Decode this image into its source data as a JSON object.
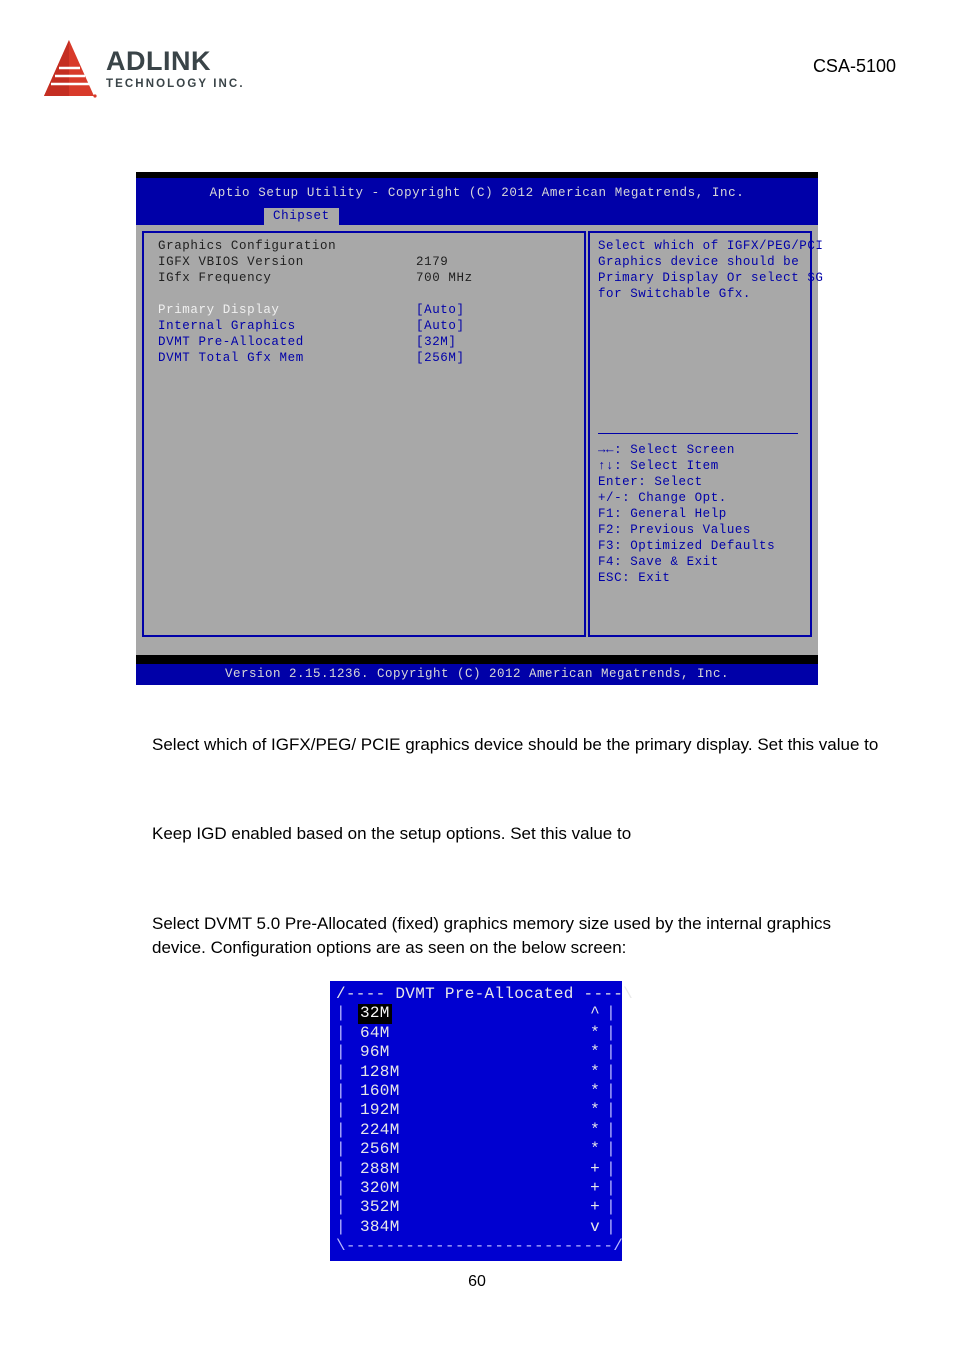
{
  "header": {
    "logo_name": "ADLINK",
    "logo_sub": "TECHNOLOGY INC.",
    "doc_id": "CSA-5100"
  },
  "bios": {
    "title": "Aptio Setup Utility - Copyright (C) 2012 American Megatrends, Inc.",
    "tab": "Chipset",
    "status": "Version 2.15.1236. Copyright (C) 2012 American Megatrends, Inc.",
    "section_heading": "Graphics Configuration",
    "info_rows": [
      {
        "label": "IGFX VBIOS Version",
        "value": "2179"
      },
      {
        "label": "IGfx Frequency",
        "value": "700 MHz"
      }
    ],
    "option_rows": [
      {
        "label": "Primary Display",
        "value": "[Auto]",
        "selected": true
      },
      {
        "label": "Internal Graphics",
        "value": "[Auto]",
        "selected": false
      },
      {
        "label": "DVMT Pre-Allocated",
        "value": "[32M]",
        "selected": false
      },
      {
        "label": "DVMT Total Gfx Mem",
        "value": "[256M]",
        "selected": false
      }
    ],
    "help_lines": [
      "Select which of IGFX/PEG/PCI",
      "Graphics device should be",
      "Primary Display Or select SG",
      "for Switchable Gfx."
    ],
    "nav_lines": [
      "→←: Select Screen",
      "↑↓: Select Item",
      "Enter: Select",
      "+/-: Change Opt.",
      "F1: General Help",
      "F2: Previous Values",
      "F3: Optimized Defaults",
      "F4: Save & Exit",
      "ESC: Exit"
    ]
  },
  "paragraphs": [
    "Select which of IGFX/PEG/ PCIE graphics device should be the primary display. Set this value to",
    "Keep IGD enabled based on the setup options. Set this value to",
    "Select DVMT 5.0 Pre-Allocated (fixed) graphics memory size used by the internal graphics device. Configuration options are as seen on the below screen:"
  ],
  "dvmt_popup": {
    "title": "/---- DVMT Pre-Allocated ----\\",
    "bottom": "\\---------------------------/",
    "border_left": "|",
    "border_right": "|",
    "items": [
      {
        "label": "32M",
        "mark": "^",
        "selected": true
      },
      {
        "label": "64M",
        "mark": "*",
        "selected": false
      },
      {
        "label": "96M",
        "mark": "*",
        "selected": false
      },
      {
        "label": "128M",
        "mark": "*",
        "selected": false
      },
      {
        "label": "160M",
        "mark": "*",
        "selected": false
      },
      {
        "label": "192M",
        "mark": "*",
        "selected": false
      },
      {
        "label": "224M",
        "mark": "*",
        "selected": false
      },
      {
        "label": "256M",
        "mark": "*",
        "selected": false
      },
      {
        "label": "288M",
        "mark": "+",
        "selected": false
      },
      {
        "label": "320M",
        "mark": "+",
        "selected": false
      },
      {
        "label": "352M",
        "mark": "+",
        "selected": false
      },
      {
        "label": "384M",
        "mark": "v",
        "selected": false
      }
    ]
  },
  "footer": {
    "page_number": "60"
  },
  "colors": {
    "bios_blue": "#0000a8",
    "bios_gray": "#a8a8a8",
    "popup_blue": "#0000d0",
    "logo_red": "#d83a2a",
    "logo_dark": "#3a4448"
  }
}
